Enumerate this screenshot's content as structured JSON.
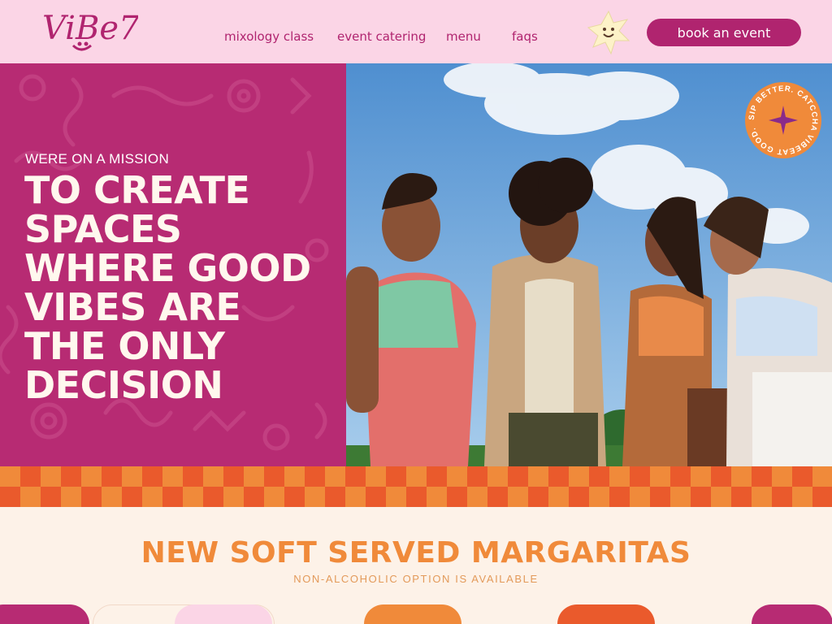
{
  "brand": {
    "name": "ViBe7"
  },
  "nav": {
    "items": [
      {
        "label": "mixology class"
      },
      {
        "label": "event catering"
      },
      {
        "label": "menu"
      },
      {
        "label": "faqs"
      }
    ],
    "cta_label": "book an event"
  },
  "hero": {
    "eyebrow": "WERE ON A MISSION",
    "headline": "TO CREATE SPACES WHERE GOOD VIBES ARE THE ONLY DECISION",
    "badge_text": "SIP BETTER. CATCCHA VIBEEAT GOOD."
  },
  "section": {
    "title": "NEW SOFT SERVED MARGARITAS",
    "subtitle": "NON-ALCOHOLIC OPTION IS AVAILABLE"
  },
  "colors": {
    "magenta": "#b72b73",
    "pink": "#fbd5e6",
    "orange": "#f08a3a",
    "red_orange": "#ea5a2c",
    "cream": "#fdf2e8"
  },
  "icons": [
    "logo-icon",
    "star-mascot-icon",
    "badge-star-icon"
  ]
}
